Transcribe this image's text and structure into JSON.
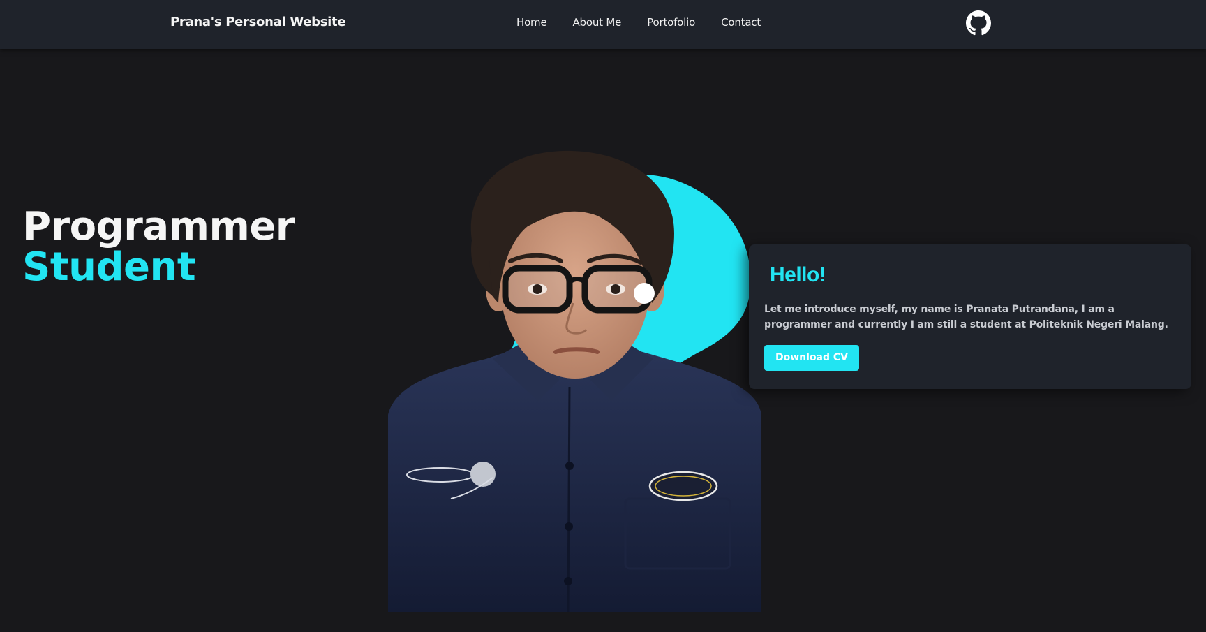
{
  "navbar": {
    "brand": "Prana's Personal Website",
    "links": [
      {
        "label": "Home"
      },
      {
        "label": "About Me"
      },
      {
        "label": "Portofolio"
      },
      {
        "label": "Contact"
      }
    ],
    "github_icon": "github-icon"
  },
  "hero": {
    "line1": "Programmer",
    "line2": "Student",
    "accent_color": "#22e4f2"
  },
  "photo": {
    "alt": "portrait photo"
  },
  "intro_card": {
    "title": "Hello!",
    "text": "Let me introduce myself, my name is Pranata Putrandana, I am a programmer and currently I am still a student at Politeknik Negeri Malang.",
    "button_label": "Download CV"
  },
  "colors": {
    "background": "#18181b",
    "navbar": "#1f232b",
    "card": "#1f232b",
    "accent": "#22e4f2"
  }
}
